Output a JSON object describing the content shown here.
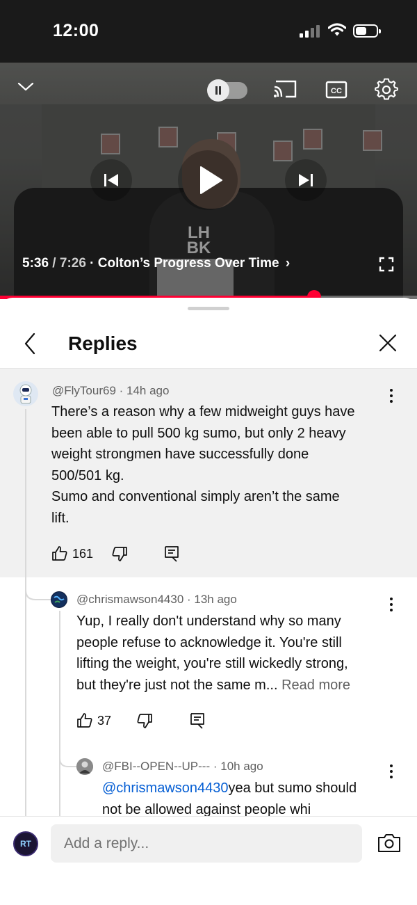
{
  "status_bar": {
    "time": "12:00"
  },
  "player": {
    "current_time": "5:36",
    "separator": " / ",
    "duration": "7:26",
    "dot": " · ",
    "chapter_title": "Colton’s Progress Over Time",
    "chapter_chevron": "›",
    "progress_fraction": 0.753,
    "shirt_text": "LH BK",
    "accent_color": "#ff0033"
  },
  "replies_panel": {
    "title": "Replies",
    "parent_comment": {
      "handle": "@FlyTour69",
      "time": "14h ago",
      "text_lines": [
        "There’s a reason why a few midweight guys have",
        "been able to pull 500 kg sumo, but only 2 heavy",
        "weight strongmen have successfully done",
        "500/501 kg.",
        "Sumo and conventional simply aren’t the same",
        "lift."
      ],
      "likes": "161"
    },
    "replies": [
      {
        "handle": "@chrismawson4430",
        "time": "13h ago",
        "text_lines": [
          "Yup, I really don't understand why so many",
          "people refuse to acknowledge it. You're still",
          "lifting the weight, you're still wickedly strong,",
          "but they're just not the same m..."
        ],
        "read_more": "Read more",
        "likes": "37"
      },
      {
        "handle": "@FBI--OPEN--UP---",
        "time": "10h ago",
        "mention": "@chrismawson4430",
        "text_first": "yea but sumo should",
        "text_second": "not be allowed against people whi"
      }
    ]
  },
  "reply_bar": {
    "placeholder": "Add a reply...",
    "my_avatar_initials": "RT"
  },
  "icons": [
    "chevron-down-icon",
    "pause-icon",
    "cast-icon",
    "cc-icon",
    "gear-icon",
    "previous-icon",
    "play-icon",
    "next-icon",
    "fullscreen-icon",
    "back-arrow-icon",
    "close-icon",
    "more-vert-icon",
    "thumbs-up-icon",
    "thumbs-down-icon",
    "reply-icon",
    "camera-icon"
  ]
}
